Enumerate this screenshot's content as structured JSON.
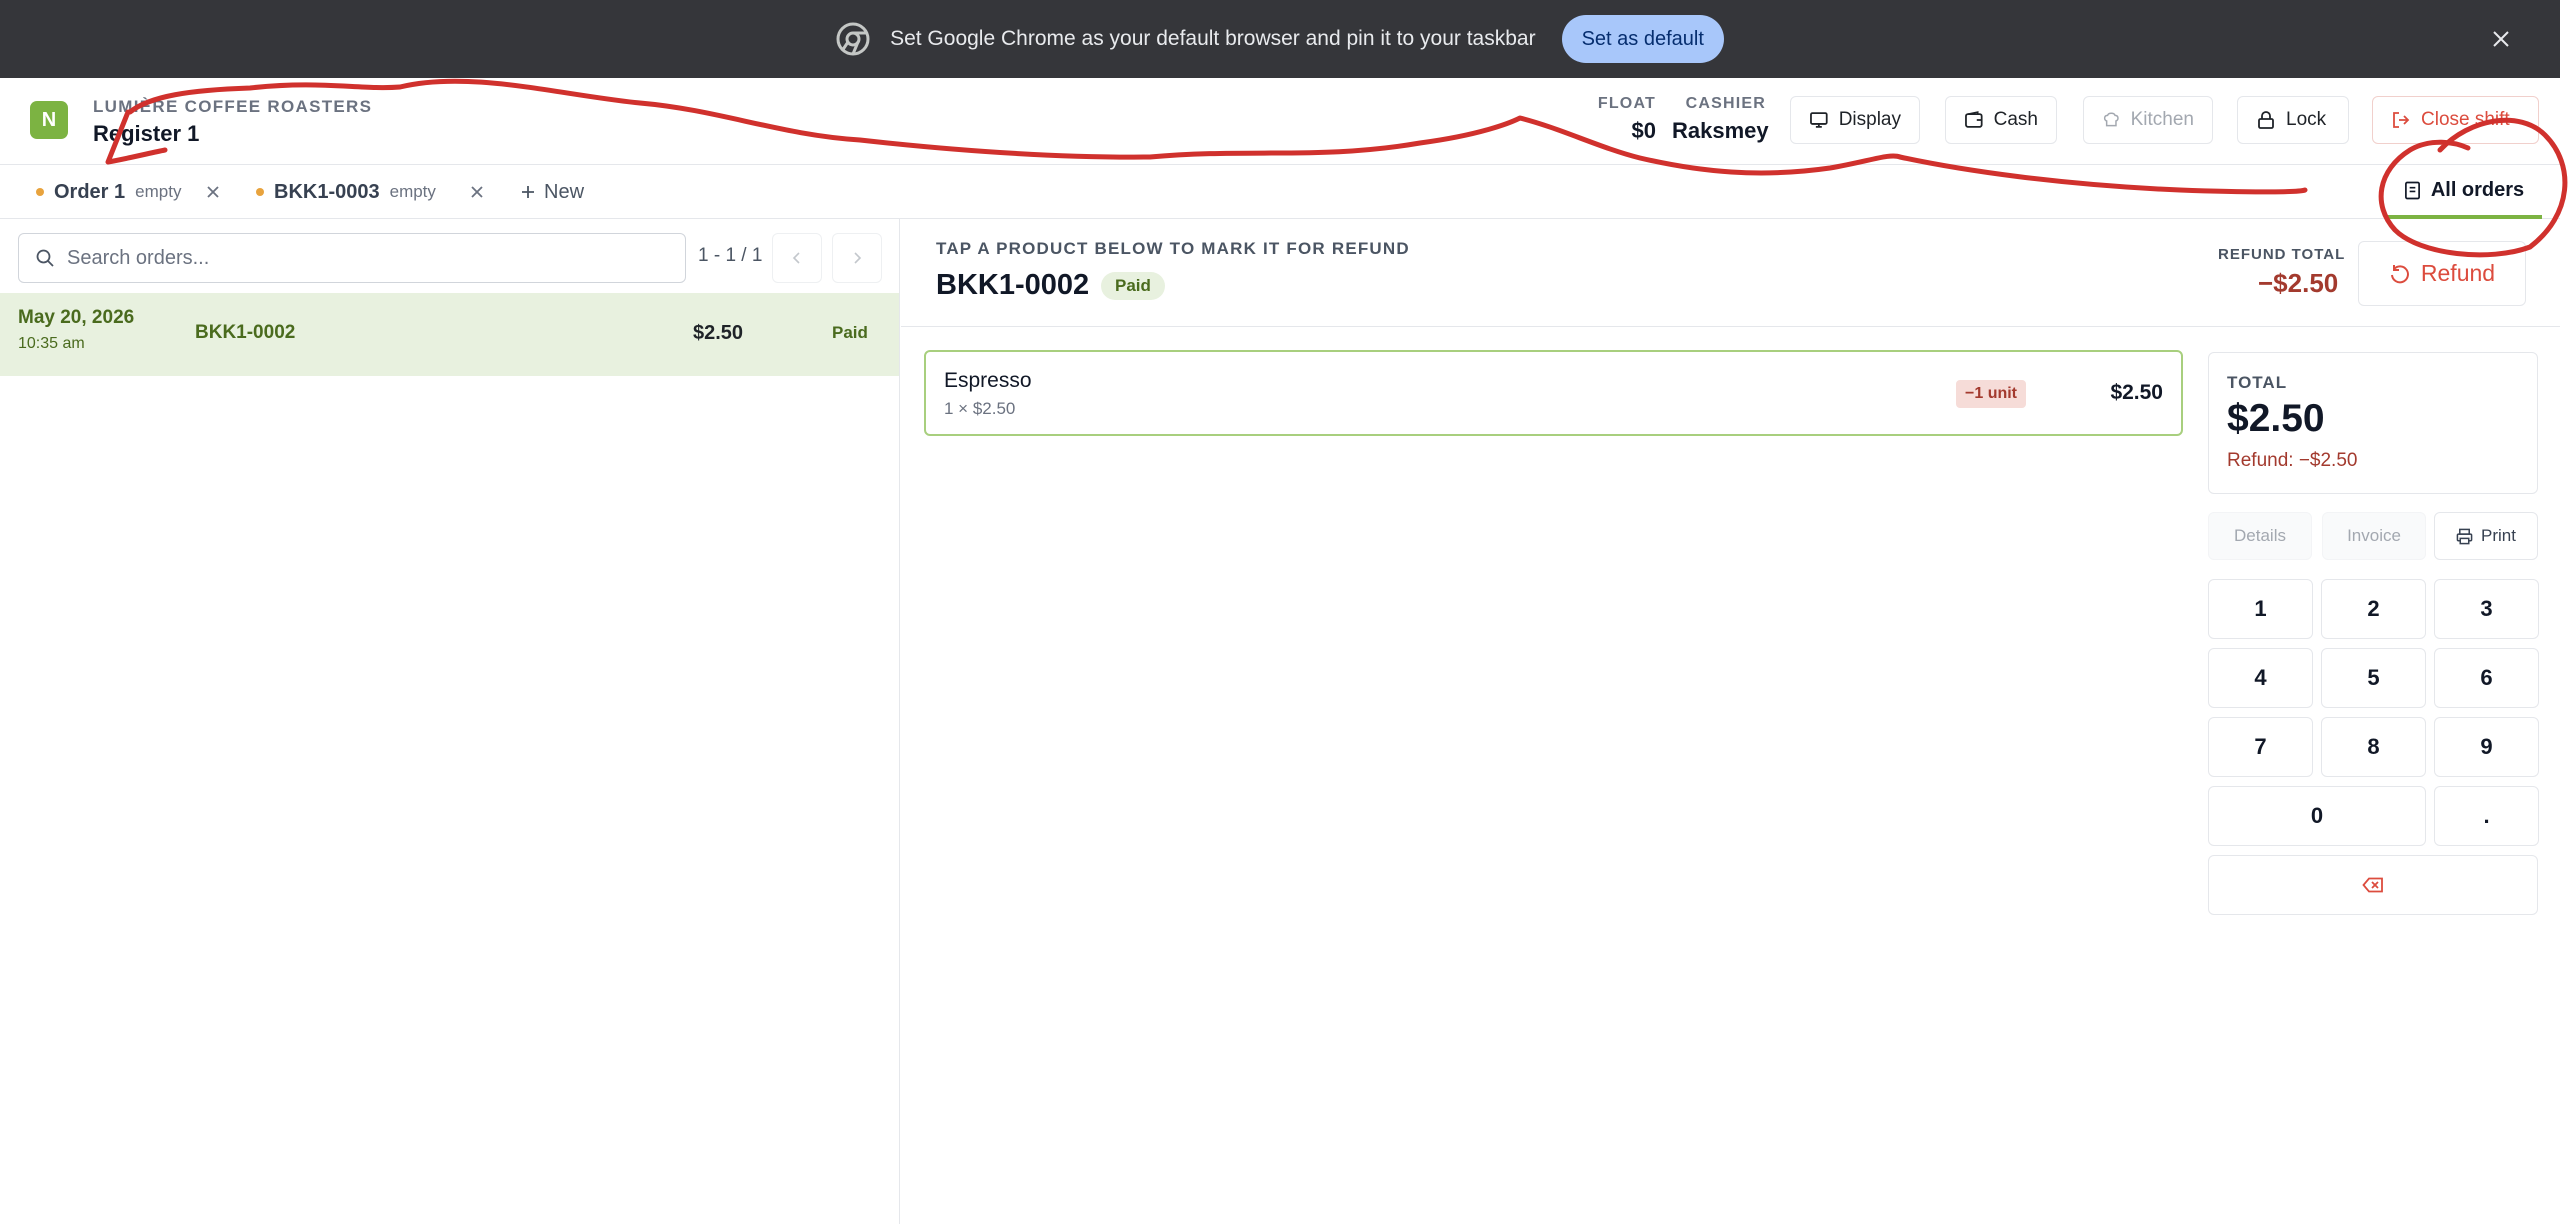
{
  "banner": {
    "message": "Set Google Chrome as your default browser and pin it to your taskbar",
    "set_default_label": "Set as default",
    "icon": "chrome-icon",
    "close_icon": "close-icon"
  },
  "header": {
    "brand": "LUMIÈRE COFFEE ROASTERS",
    "register": "Register 1",
    "logo_letter": "N",
    "float_label": "FLOAT",
    "float_value": "$0",
    "cashier_label": "CASHIER",
    "cashier_value": "Raksmey",
    "buttons": {
      "display": "Display",
      "cash": "Cash",
      "kitchen": "Kitchen",
      "lock": "Lock",
      "close_shift": "Close shift"
    }
  },
  "tabs": [
    {
      "name": "Order 1",
      "meta": "empty"
    },
    {
      "name": "BKK1-0003",
      "meta": "empty"
    }
  ],
  "new_tab_label": "New",
  "all_orders_label": "All orders",
  "orders_list": {
    "search_placeholder": "Search orders...",
    "pager": "1 - 1 / 1",
    "rows": [
      {
        "date": "May 20, 2026",
        "time": "10:35 am",
        "ref": "BKK1-0002",
        "amount": "$2.50",
        "status": "Paid"
      }
    ]
  },
  "refund": {
    "hint": "TAP A PRODUCT BELOW TO MARK IT FOR REFUND",
    "order_ref": "BKK1-0002",
    "status": "Paid",
    "refund_total_label": "REFUND TOTAL",
    "refund_total_value": "−$2.50",
    "refund_button": "Refund"
  },
  "items": [
    {
      "name": "Espresso",
      "qty": "1 × $2.50",
      "badge": "−1 unit",
      "price": "$2.50"
    }
  ],
  "summary": {
    "total_label": "TOTAL",
    "total_value": "$2.50",
    "refund_line": "Refund: −$2.50",
    "details": "Details",
    "invoice": "Invoice",
    "print": "Print"
  },
  "keypad": [
    "1",
    "2",
    "3",
    "4",
    "5",
    "6",
    "7",
    "8",
    "9",
    "0",
    "."
  ],
  "colors": {
    "accent": "#7cb342",
    "danger": "#dc4c3e",
    "annotation": "#d0312d"
  }
}
